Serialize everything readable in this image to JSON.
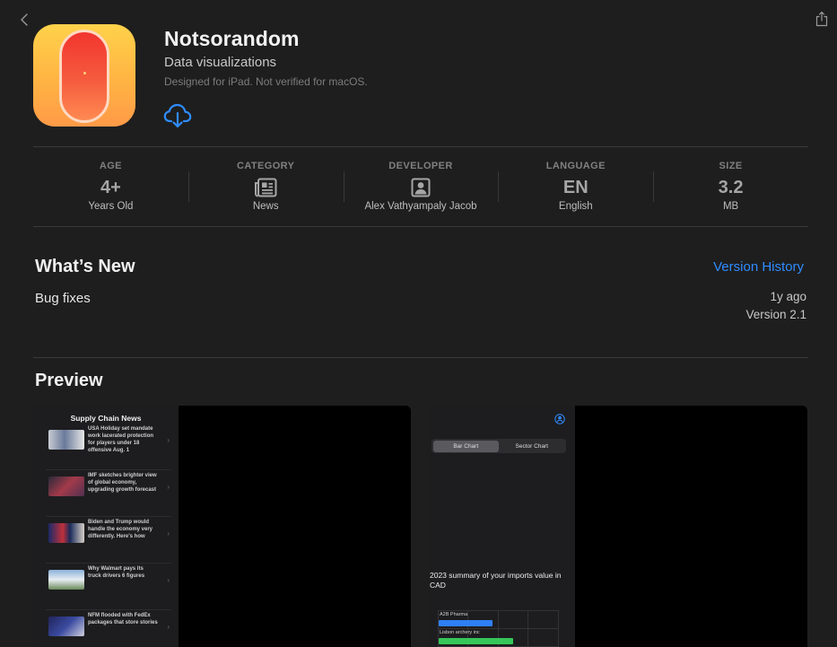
{
  "header": {
    "title": "Notsorandom",
    "subtitle": "Data visualizations",
    "note": "Designed for iPad. Not verified for macOS."
  },
  "info": [
    {
      "label": "AGE",
      "value": "4+",
      "sub": "Years Old"
    },
    {
      "label": "CATEGORY",
      "value": "",
      "icon": "newspaper-icon",
      "sub": "News"
    },
    {
      "label": "DEVELOPER",
      "value": "",
      "icon": "person-icon",
      "sub": "Alex Vathyampaly Jacob"
    },
    {
      "label": "LANGUAGE",
      "value": "EN",
      "sub": "English"
    },
    {
      "label": "SIZE",
      "value": "3.2",
      "sub": "MB"
    }
  ],
  "whats_new": {
    "title": "What’s New",
    "version_history_label": "Version History",
    "notes": "Bug fixes",
    "ago": "1y ago",
    "version": "Version 2.1"
  },
  "preview": {
    "title": "Preview",
    "shot1": {
      "panel_title": "Supply Chain News",
      "items": [
        {
          "text": "USA Holiday set mandate work lacerated protection for players under 18 offensive Aug. 1"
        },
        {
          "text": "IMF sketches brighter view of global economy, upgrading growth forecast"
        },
        {
          "text": "Biden and Trump would handle the economy very differently. Here's how"
        },
        {
          "text": "Why Walmart pays its truck drivers 6 figures"
        },
        {
          "text": "NFM flooded with FedEx packages that store stories"
        }
      ]
    },
    "shot2": {
      "segments": [
        "Bar Chart",
        "Sector Chart"
      ],
      "caption": "2023 summary of your imports value in CAD",
      "bars": [
        {
          "label": "A2B Pharma",
          "value": 0.45,
          "color": "#2f7ff5"
        },
        {
          "label": "Lisbon archery inc",
          "value": 0.62,
          "color": "#35c759"
        }
      ]
    }
  },
  "colors": {
    "accent": "#2f8cff",
    "background": "#1e1e1e"
  }
}
